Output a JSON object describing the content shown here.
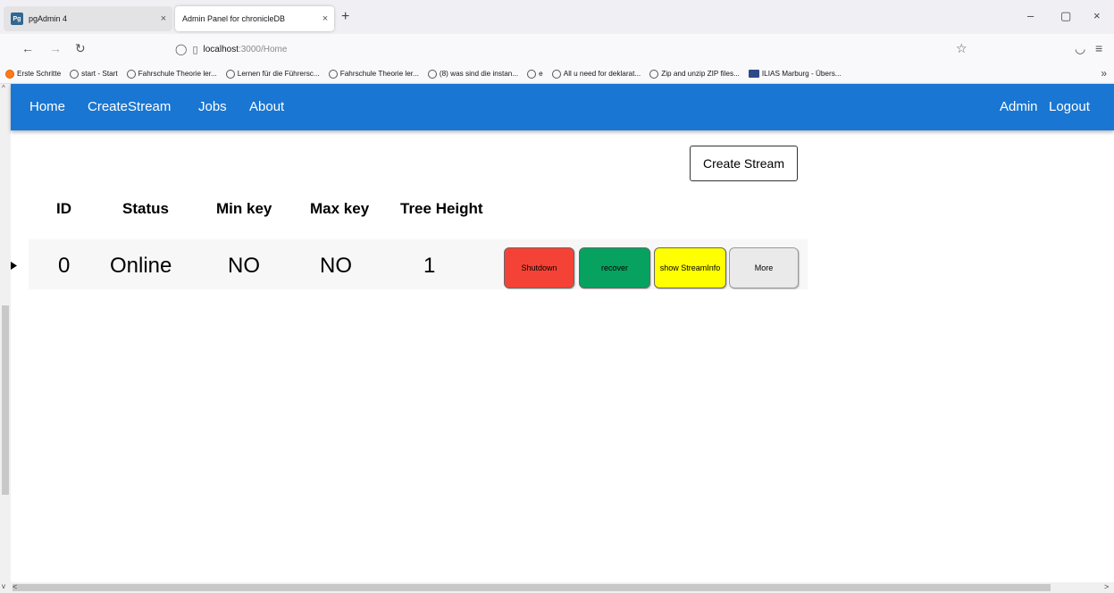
{
  "browser": {
    "tabs": [
      {
        "favicon": "Pg",
        "title": "pgAdmin 4",
        "close": "×",
        "active": false
      },
      {
        "title": "Admin Panel for chronicleDB",
        "close": "×",
        "active": true
      }
    ],
    "new_tab": "+",
    "window_controls": {
      "minimize": "–",
      "restore": "▢",
      "close": "×"
    },
    "url_host": "localhost",
    "url_path": ":3000/Home",
    "bookmarks": [
      "Erste Schritte",
      "start - Start",
      "Fahrschule Theorie ler...",
      "Lernen für die Führersc...",
      "Fahrschule Theorie ler...",
      "(8) was sind die instan...",
      "e",
      "All u need for deklarat...",
      "Zip and unzip ZIP files...",
      "ILIAS Marburg - Übers..."
    ],
    "bookmarks_more": "»"
  },
  "app_nav": {
    "links": [
      "Home",
      "CreateStream",
      "Jobs",
      "About"
    ],
    "right_links": [
      "Admin",
      "Logout"
    ],
    "color": "#1976d2"
  },
  "main": {
    "create_stream_label": "Create Stream",
    "table": {
      "headers": [
        "ID",
        "Status",
        "Min key",
        "Max key",
        "Tree Height"
      ],
      "rows": [
        {
          "id": "0",
          "status": "Online",
          "min_key": "NO",
          "max_key": "NO",
          "tree_height": "1"
        }
      ]
    },
    "actions": {
      "shutdown": "Shutdown",
      "recover": "recover",
      "show_stream_info_line1": "show Stream",
      "show_stream_info_line2": "Info",
      "more": "More"
    },
    "colors": {
      "shutdown": "#f44336",
      "recover": "#07a260",
      "show_info": "#ffff00",
      "more": "#eaeaea"
    }
  }
}
